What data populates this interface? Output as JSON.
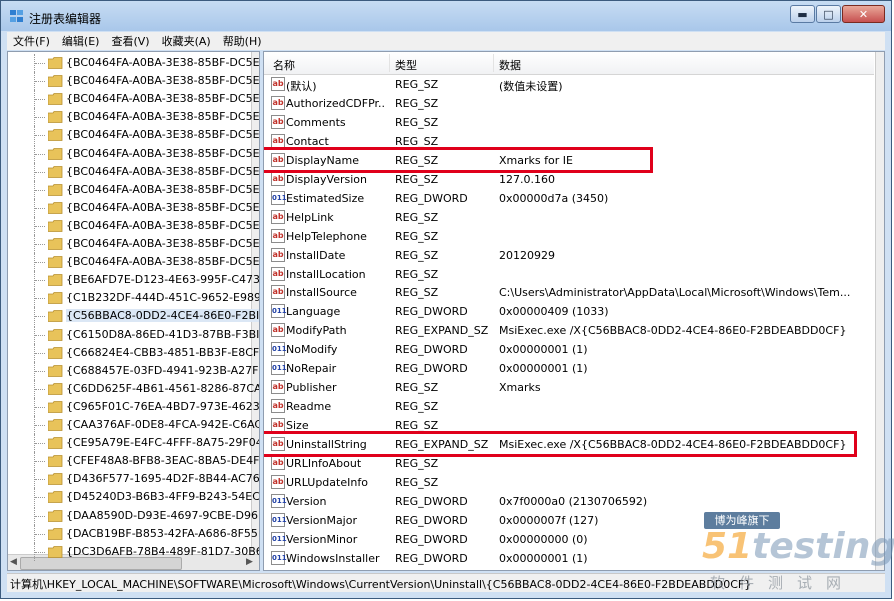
{
  "window": {
    "title": "注册表编辑器",
    "buttons": {
      "minimize": "▬",
      "maximize": "□",
      "close": "✕"
    }
  },
  "menu": [
    "文件(F)",
    "编辑(E)",
    "查看(V)",
    "收藏夹(A)",
    "帮助(H)"
  ],
  "tree": {
    "items": [
      "{BC0464FA-A0BA-3E38-85BF-DC5E",
      "{BC0464FA-A0BA-3E38-85BF-DC5E",
      "{BC0464FA-A0BA-3E38-85BF-DC5E",
      "{BC0464FA-A0BA-3E38-85BF-DC5E",
      "{BC0464FA-A0BA-3E38-85BF-DC5E",
      "{BC0464FA-A0BA-3E38-85BF-DC5E",
      "{BC0464FA-A0BA-3E38-85BF-DC5E",
      "{BC0464FA-A0BA-3E38-85BF-DC5E",
      "{BC0464FA-A0BA-3E38-85BF-DC5E",
      "{BC0464FA-A0BA-3E38-85BF-DC5E",
      "{BC0464FA-A0BA-3E38-85BF-DC5E",
      "{BC0464FA-A0BA-3E38-85BF-DC5E",
      "{BE6AFD7E-D123-4E63-995F-C473",
      "{C1B232DF-444D-451C-9652-E989",
      "{C56BBAC8-0DD2-4CE4-86E0-F2BI",
      "{C6150D8A-86ED-41D3-87BB-F3BI",
      "{C66824E4-CBB3-4851-BB3F-E8CF",
      "{C688457E-03FD-4941-923B-A27F",
      "{C6DD625F-4B61-4561-8286-87CA",
      "{C965F01C-76EA-4BD7-973E-4623",
      "{CAA376AF-0DE8-4FCA-942E-C6AC",
      "{CE95A79E-E4FC-4FFF-8A75-29F04",
      "{CFEF48A8-BFB8-3EAC-8BA5-DE4F",
      "{D436F577-1695-4D2F-8B44-AC76",
      "{D45240D3-B6B3-4FF9-B243-54EC",
      "{DAA8590D-D93E-4697-9CBE-D96",
      "{DACB19BF-B853-42FA-A686-8F55",
      "{DC3D6AFB-78B4-489F-81D7-30B6"
    ],
    "selected_index": 14
  },
  "list": {
    "columns": {
      "name": "名称",
      "type": "类型",
      "data": "数据"
    },
    "rows": [
      {
        "name": "(默认)",
        "type": "REG_SZ",
        "data": "(数值未设置)",
        "kind": "sz"
      },
      {
        "name": "AuthorizedCDFPr...",
        "type": "REG_SZ",
        "data": "",
        "kind": "sz"
      },
      {
        "name": "Comments",
        "type": "REG_SZ",
        "data": "",
        "kind": "sz"
      },
      {
        "name": "Contact",
        "type": "REG_SZ",
        "data": "",
        "kind": "sz"
      },
      {
        "name": "DisplayName",
        "type": "REG_SZ",
        "data": "Xmarks for IE",
        "kind": "sz"
      },
      {
        "name": "DisplayVersion",
        "type": "REG_SZ",
        "data": "127.0.160",
        "kind": "sz"
      },
      {
        "name": "EstimatedSize",
        "type": "REG_DWORD",
        "data": "0x00000d7a (3450)",
        "kind": "dword"
      },
      {
        "name": "HelpLink",
        "type": "REG_SZ",
        "data": "",
        "kind": "sz"
      },
      {
        "name": "HelpTelephone",
        "type": "REG_SZ",
        "data": "",
        "kind": "sz"
      },
      {
        "name": "InstallDate",
        "type": "REG_SZ",
        "data": "20120929",
        "kind": "sz"
      },
      {
        "name": "InstallLocation",
        "type": "REG_SZ",
        "data": "",
        "kind": "sz"
      },
      {
        "name": "InstallSource",
        "type": "REG_SZ",
        "data": "C:\\Users\\Administrator\\AppData\\Local\\Microsoft\\Windows\\Tem...",
        "kind": "sz"
      },
      {
        "name": "Language",
        "type": "REG_DWORD",
        "data": "0x00000409 (1033)",
        "kind": "dword"
      },
      {
        "name": "ModifyPath",
        "type": "REG_EXPAND_SZ",
        "data": "MsiExec.exe /X{C56BBAC8-0DD2-4CE4-86E0-F2BDEABDD0CF}",
        "kind": "sz"
      },
      {
        "name": "NoModify",
        "type": "REG_DWORD",
        "data": "0x00000001 (1)",
        "kind": "dword"
      },
      {
        "name": "NoRepair",
        "type": "REG_DWORD",
        "data": "0x00000001 (1)",
        "kind": "dword"
      },
      {
        "name": "Publisher",
        "type": "REG_SZ",
        "data": "Xmarks",
        "kind": "sz"
      },
      {
        "name": "Readme",
        "type": "REG_SZ",
        "data": "",
        "kind": "sz"
      },
      {
        "name": "Size",
        "type": "REG_SZ",
        "data": "",
        "kind": "sz"
      },
      {
        "name": "UninstallString",
        "type": "REG_EXPAND_SZ",
        "data": "MsiExec.exe /X{C56BBAC8-0DD2-4CE4-86E0-F2BDEABDD0CF}",
        "kind": "sz"
      },
      {
        "name": "URLInfoAbout",
        "type": "REG_SZ",
        "data": "",
        "kind": "sz"
      },
      {
        "name": "URLUpdateInfo",
        "type": "REG_SZ",
        "data": "",
        "kind": "sz"
      },
      {
        "name": "Version",
        "type": "REG_DWORD",
        "data": "0x7f0000a0 (2130706592)",
        "kind": "dword"
      },
      {
        "name": "VersionMajor",
        "type": "REG_DWORD",
        "data": "0x0000007f (127)",
        "kind": "dword"
      },
      {
        "name": "VersionMinor",
        "type": "REG_DWORD",
        "data": "0x00000000 (0)",
        "kind": "dword"
      },
      {
        "name": "WindowsInstaller",
        "type": "REG_DWORD",
        "data": "0x00000001 (1)",
        "kind": "dword"
      }
    ],
    "highlighted_rows": [
      4,
      19
    ],
    "icon_labels": {
      "sz": "ab",
      "dword": "011"
    }
  },
  "status": "计算机\\HKEY_LOCAL_MACHINE\\SOFTWARE\\Microsoft\\Windows\\CurrentVersion\\Uninstall\\{C56BBAC8-0DD2-4CE4-86E0-F2BDEABDD0CF}",
  "watermark": {
    "badge": "博为峰旗下",
    "logo_prefix": "51",
    "logo_rest": "testing",
    "sub": "软件测试网"
  },
  "colors": {
    "highlight": "#e0001b",
    "folder": "#e8c35a",
    "titlebar": "#b3cdee"
  }
}
